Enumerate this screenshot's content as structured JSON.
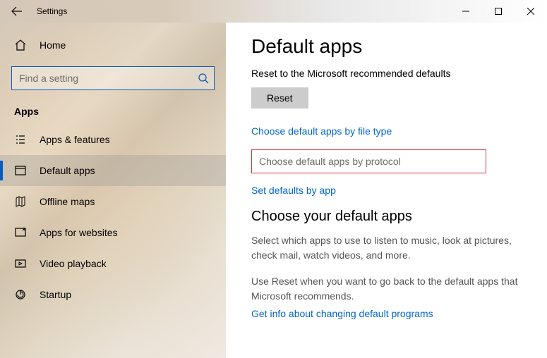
{
  "titlebar": {
    "title": "Settings"
  },
  "sidebar": {
    "home_label": "Home",
    "search_placeholder": "Find a setting",
    "section_title": "Apps",
    "items": [
      {
        "label": "Apps & features"
      },
      {
        "label": "Default apps"
      },
      {
        "label": "Offline maps"
      },
      {
        "label": "Apps for websites"
      },
      {
        "label": "Video playback"
      },
      {
        "label": "Startup"
      }
    ]
  },
  "main": {
    "heading": "Default apps",
    "reset_sub": "Reset to the Microsoft recommended defaults",
    "reset_label": "Reset",
    "link_filetype": "Choose default apps by file type",
    "link_protocol": "Choose default apps by protocol",
    "link_byapp": "Set defaults by app",
    "choose_heading": "Choose your default apps",
    "desc1": "Select which apps to use to listen to music, look at pictures, check mail, watch videos, and more.",
    "desc2": "Use Reset when you want to go back to the default apps that Microsoft recommends.",
    "link_info": "Get info about changing default programs"
  }
}
